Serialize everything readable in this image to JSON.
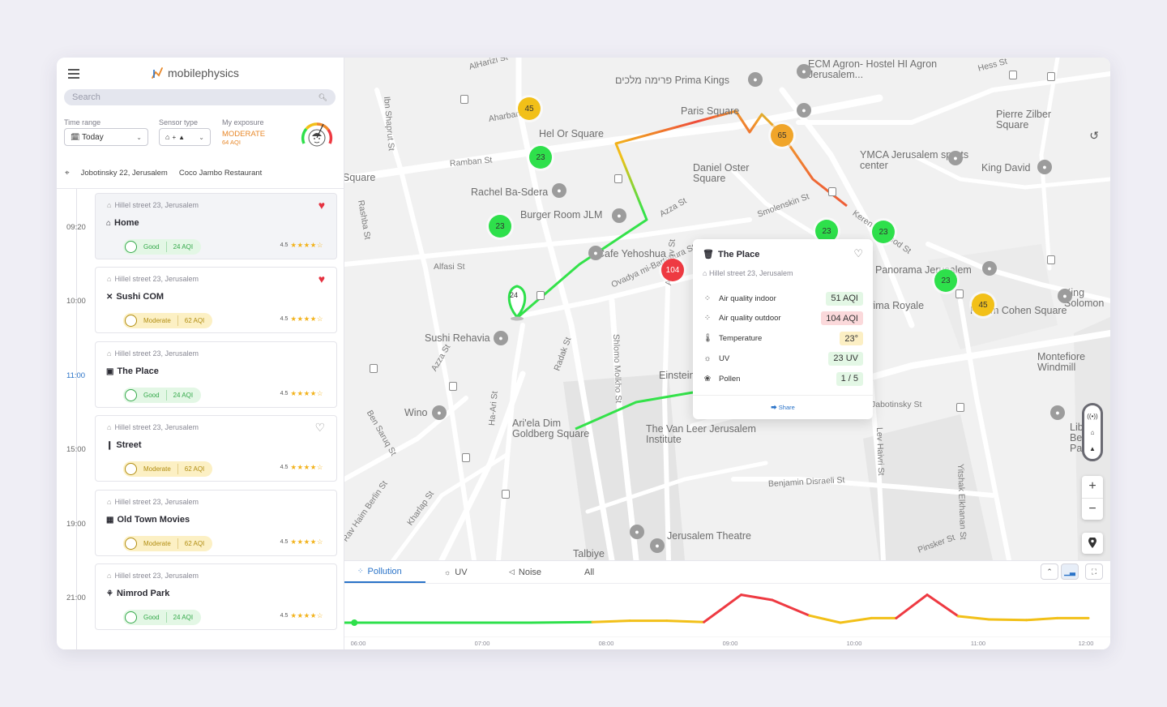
{
  "app": {
    "logo_text": "mobilephysics",
    "search": {
      "placeholder": "Search"
    },
    "filters": {
      "time_range_label": "Time range",
      "time_range_value": "Today",
      "sensor_type_label": "Sensor type",
      "sensor_type_value": "+",
      "exposure_label": "My exposure",
      "exposure_value": "MODERATE",
      "exposure_aqi": "64 AQI"
    },
    "location": {
      "address": "Jobotinsky 22, Jerusalem",
      "place": "Coco Jambo Restaurant"
    }
  },
  "timeline": [
    {
      "time": "09:20",
      "active": false,
      "address": "Hillel street 23, Jerusalem",
      "name": "Home",
      "icon": "home-icon",
      "favorite": true,
      "status": "Good",
      "aqi": "24 AQI",
      "rating": "4.5",
      "stars": "★★★★☆",
      "selected": true
    },
    {
      "time": "10:00",
      "active": false,
      "address": "Hillel street 23, Jerusalem",
      "name": "Sushi COM",
      "icon": "restaurant-icon",
      "favorite": true,
      "status": "Moderate",
      "aqi": "62 AQI",
      "rating": "4.5",
      "stars": "★★★★☆"
    },
    {
      "time": "11:00",
      "active": true,
      "address": "Hillel street 23, Jerusalem",
      "name": "The Place",
      "icon": "venue-icon",
      "favorite": false,
      "status": "Good",
      "aqi": "24 AQI",
      "rating": "4.5",
      "stars": "★★★★☆"
    },
    {
      "time": "15:00",
      "active": false,
      "address": "Hillel street 23, Jerusalem",
      "name": "Street",
      "icon": "street-icon",
      "favorite": false,
      "heart_outline": true,
      "status": "Moderate",
      "aqi": "62 AQI",
      "rating": "4.5",
      "stars": "★★★★☆"
    },
    {
      "time": "19:00",
      "active": false,
      "address": "Hillel street 23, Jerusalem",
      "name": "Old Town Movies",
      "icon": "cinema-icon",
      "favorite": false,
      "status": "Moderate",
      "aqi": "62 AQI",
      "rating": "4.5",
      "stars": "★★★★☆"
    },
    {
      "time": "21:00",
      "active": false,
      "address": "Hillel street 23, Jerusalem",
      "name": "Nimrod Park",
      "icon": "park-icon",
      "favorite": false,
      "status": "Good",
      "aqi": "24 AQI",
      "rating": "4.5",
      "stars": "★★★★☆"
    }
  ],
  "map": {
    "streets": [
      "AlHarizi St",
      "Ibn Shaprut St",
      "Aharbanel St",
      "Ramban St",
      "Rashba St",
      "Alfasi St",
      "Azza St",
      "Smolenskin St",
      "Keren Hayesod St",
      "Ovadya mi-Bartenura St",
      "Arlozorov St",
      "Shlomo Molkho St",
      "Radak St",
      "Ha-Ari St",
      "Ben Saruq St",
      "Azza St",
      "Rav Haim Berlin St",
      "Kharlap St",
      "Jabotinsky St",
      "Lev Haivri St",
      "Benjamin Disraeli St",
      "Yitshak Elkhanan St",
      "Pinsker St",
      "Hess St"
    ],
    "pois": [
      "ECM Agron- Hostel HI Agron Jerusalem...",
      "פרימה מלכים Prima Kings",
      "Paris Square",
      "Hel Or Square",
      "Daniel Oster Square",
      "YMCA Jerusalem sports center",
      "King David",
      "Pierre Zilber Square",
      "Square",
      "Rachel Ba-Sdera",
      "Burger Room JLM",
      "Cafe Yehoshua",
      "Panorama Jerusalem",
      "Prima Royale",
      "Hayim Cohen Square",
      "King Solomon",
      "Montefiore Windmill",
      "Sushi Rehavia",
      "Wino",
      "Einstein Square",
      "Ari'ela Dim Goldberg Square",
      "The Van Leer Jerusalem Institute",
      "Liberty Bell Park",
      "Jerusalem Theatre",
      "Talbiye"
    ],
    "markers": [
      "45",
      "23",
      "23",
      "65",
      "23",
      "23",
      "23",
      "45",
      "104",
      "24"
    ],
    "popup": {
      "title": "The Place",
      "address": "Hillel street 23, Jerusalem",
      "rows": [
        {
          "label": "Air quality indoor",
          "value": "51 AQI",
          "tone": "g",
          "icon": "air-indoor-icon"
        },
        {
          "label": "Air quality outdoor",
          "value": "104 AQI",
          "tone": "r",
          "icon": "air-outdoor-icon"
        },
        {
          "label": "Temperature",
          "value": "23°",
          "tone": "y",
          "icon": "thermometer-icon"
        },
        {
          "label": "UV",
          "value": "23 UV",
          "tone": "g",
          "icon": "sun-icon"
        },
        {
          "label": "Pollen",
          "value": "1 / 5",
          "tone": "g",
          "icon": "pollen-icon"
        }
      ],
      "share": "Share"
    }
  },
  "bottom": {
    "tabs": [
      "Pollution",
      "UV",
      "Noise",
      "All"
    ],
    "active_tab": "Pollution"
  },
  "chart_data": {
    "type": "line",
    "title": "",
    "xlabel": "",
    "ylabel": "",
    "x_ticks": [
      "06:00",
      "07:00",
      "08:00",
      "09:00",
      "10:00",
      "11:00",
      "12:00"
    ],
    "x": [
      6.0,
      6.5,
      7.0,
      7.5,
      8.0,
      8.3,
      8.6,
      8.9,
      9.2,
      9.45,
      9.75,
      10.0,
      10.25,
      10.45,
      10.7,
      10.95,
      11.2,
      11.5,
      11.75,
      12.0
    ],
    "series": [
      {
        "values": [
          5,
          5,
          5,
          5,
          6,
          8,
          8,
          6,
          48,
          40,
          16,
          5,
          12,
          12,
          48,
          15,
          10,
          9,
          12,
          12
        ]
      }
    ],
    "ylim": [
      0,
      60
    ],
    "color_scale": {
      "low": "#2ee04b",
      "mid": "#f2c018",
      "high": "#ee3a42"
    },
    "grid": false
  },
  "colors": {
    "accent": "#2a73c8",
    "good": "#2ee04b",
    "moderate": "#f2c018",
    "bad": "#ee3a42",
    "route_green": "#34e24a"
  }
}
